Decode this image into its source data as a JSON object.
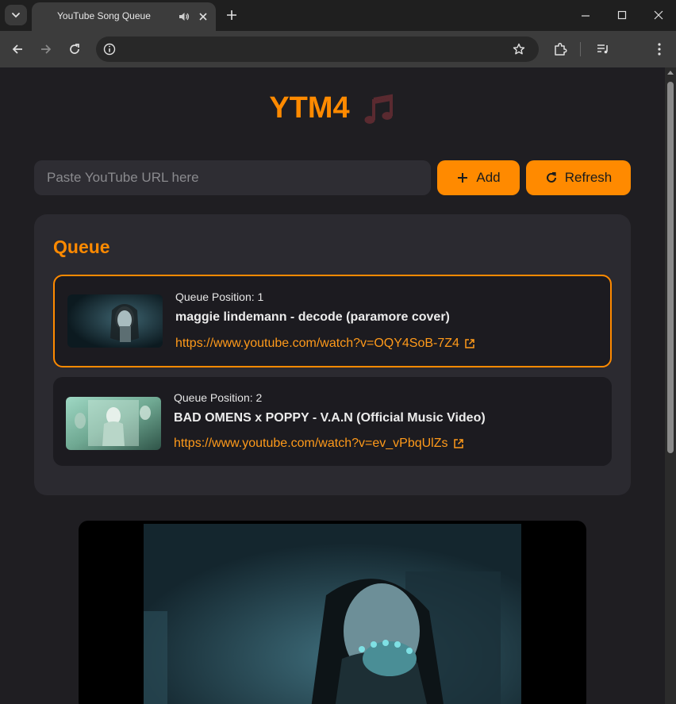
{
  "browser": {
    "tab_title": "YouTube Song Queue",
    "address": ""
  },
  "app": {
    "title": "YTM4"
  },
  "search": {
    "placeholder": "Paste YouTube URL here",
    "value": ""
  },
  "buttons": {
    "add_label": "Add",
    "refresh_label": "Refresh"
  },
  "queue": {
    "heading": "Queue",
    "items": [
      {
        "position_label": "Queue Position: 1",
        "title": "maggie lindemann - decode (paramore cover)",
        "url": "https://www.youtube.com/watch?v=OQY4SoB-7Z4"
      },
      {
        "position_label": "Queue Position: 2",
        "title": "BAD OMENS x POPPY - V.A.N (Official Music Video)",
        "url": "https://www.youtube.com/watch?v=ev_vPbqUlZs"
      }
    ]
  },
  "colors": {
    "accent": "#ff8a00",
    "background": "#1f1e22",
    "panel": "#2b2a30"
  }
}
